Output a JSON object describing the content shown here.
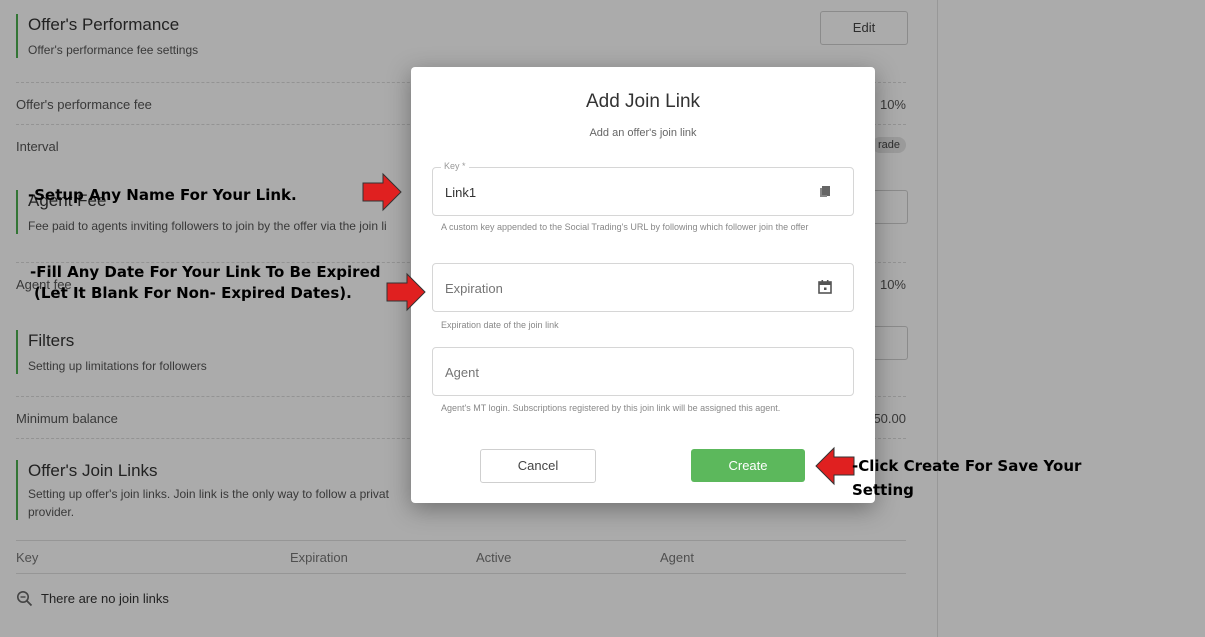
{
  "performance": {
    "title": "Offer's Performance",
    "subtitle": "Offer's performance fee settings",
    "edit_label": "Edit",
    "fee_label": "Offer's performance fee",
    "fee_value": "10%",
    "interval_label": "Interval",
    "interval_chip": "rade"
  },
  "agent_fee": {
    "title": "Agent Fee",
    "subtitle": "Fee paid to agents inviting followers to join by the offer via the join li",
    "fee_label": "Agent fee",
    "fee_value": "10%"
  },
  "filters": {
    "title": "Filters",
    "subtitle": "Setting up limitations for followers",
    "min_balance_label": "Minimum balance",
    "min_balance_value": "50.00"
  },
  "join_links": {
    "title": "Offer's Join Links",
    "subtitle_line1": "Setting up offer's join links. Join link is the only way to follow a privat",
    "subtitle_line2": "provider.",
    "columns": [
      "Key",
      "Expiration",
      "Active",
      "Agent"
    ],
    "empty_text": "There are no join links"
  },
  "modal": {
    "title": "Add Join Link",
    "subtitle": "Add an offer's join link",
    "key": {
      "legend": "Key *",
      "value": "Link1",
      "helper": "A custom key appended to the Social Trading's URL by following which follower join the offer",
      "icon": "copy-icon"
    },
    "expiration": {
      "placeholder": "Expiration",
      "helper": "Expiration date of the join link",
      "icon": "calendar-icon"
    },
    "agent": {
      "placeholder": "Agent",
      "helper": "Agent's MT login. Subscriptions registered by this join link will be assigned this agent."
    },
    "cancel_label": "Cancel",
    "create_label": "Create"
  },
  "annotations": {
    "name_tip": "-Setup Any Name For Your Link.",
    "date_tip_line1": "-Fill Any Date For Your Link To Be Expired",
    "date_tip_line2": "(Let It Blank For Non- Expired Dates).",
    "create_tip_line1": "-Click Create For Save Your",
    "create_tip_line2": "Setting"
  },
  "colors": {
    "accent_green": "#5cb85c",
    "section_bar": "#4caf50",
    "arrow_red": "#e02020"
  }
}
